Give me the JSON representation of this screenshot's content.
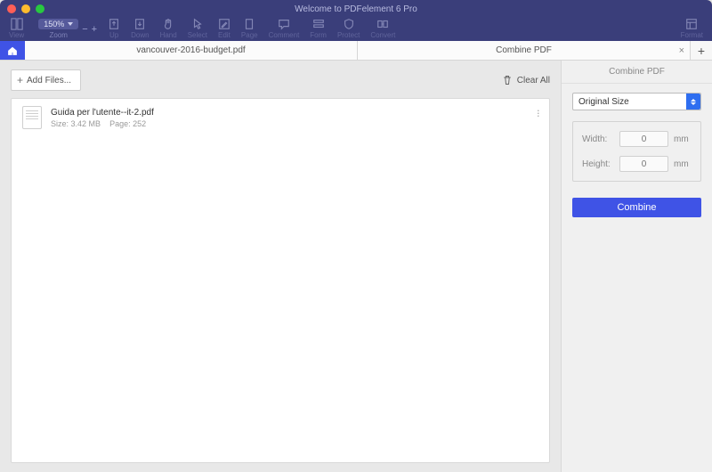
{
  "window": {
    "title": "Welcome to PDFelement 6 Pro"
  },
  "toolbar": {
    "zoom_value": "150%",
    "items": [
      "View",
      "Zoom",
      "Up",
      "Down",
      "Hand",
      "Select",
      "Edit",
      "Page",
      "Comment",
      "Form",
      "Protect",
      "Convert",
      "Format"
    ]
  },
  "tabs": {
    "tab1": "vancouver-2016-budget.pdf",
    "tab2": "Combine PDF"
  },
  "actions": {
    "add_files": "Add Files...",
    "clear_all": "Clear All"
  },
  "files": [
    {
      "name": "Guida per l'utente--it-2.pdf",
      "size_label": "Size:",
      "size": "3.42 MB",
      "page_label": "Page:",
      "page": "252"
    }
  ],
  "sidebar": {
    "title": "Combine PDF",
    "size_select": "Original Size",
    "width_label": "Width:",
    "height_label": "Height:",
    "width_value": "0",
    "height_value": "0",
    "unit": "mm",
    "combine_btn": "Combine"
  }
}
